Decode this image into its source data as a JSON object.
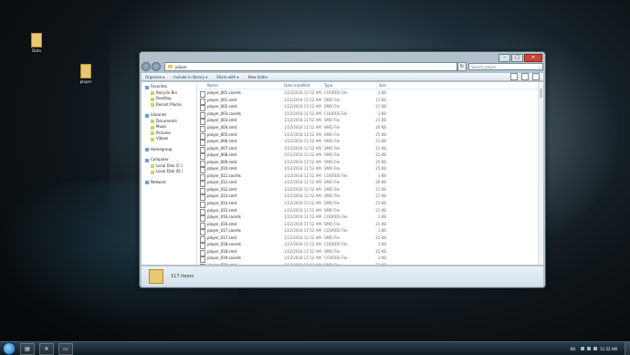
{
  "desktop": {
    "icons": [
      {
        "label": "Data"
      },
      {
        "label": "player"
      }
    ]
  },
  "window": {
    "address_path": "player",
    "search_placeholder": "Search player",
    "window_controls": {
      "minimize": "–",
      "maximize": "□",
      "close": "✕"
    },
    "toolbar": {
      "organize": "Organize ▾",
      "include_in_library": "Include in library ▾",
      "share_with": "Share with ▾",
      "new_folder": "New folder"
    },
    "nav_pane": {
      "favorites": "Favorites",
      "recycle_bin": "Recycle Bin",
      "desktop": "Desktop",
      "recent_places": "Recent Places",
      "libraries": "Libraries",
      "documents": "Documents",
      "music": "Music",
      "pictures": "Pictures",
      "videos": "Videos",
      "homegroup": "Homegroup",
      "computer": "Computer",
      "local_disk_c": "Local Disk (C:)",
      "local_disk_d": "Local Disk (D:)",
      "network": "Network"
    },
    "columns": {
      "name": "Name",
      "date": "Date modified",
      "type": "Type",
      "size": "Size"
    },
    "files": [
      {
        "name": "player_001.coords",
        "date": "1/22/2018 11:52 AM",
        "type": "COORDS File",
        "size": "1 KB"
      },
      {
        "name": "player_001.smd",
        "date": "1/22/2018 11:52 AM",
        "type": "SMD File",
        "size": "12 KB"
      },
      {
        "name": "player_002.smd",
        "date": "1/22/2018 11:52 AM",
        "type": "SMD File",
        "size": "21 KB"
      },
      {
        "name": "player_003.coords",
        "date": "1/22/2018 11:52 AM",
        "type": "COORDS File",
        "size": "1 KB"
      },
      {
        "name": "player_003.smd",
        "date": "1/22/2018 11:52 AM",
        "type": "SMD File",
        "size": "21 KB"
      },
      {
        "name": "player_004.smd",
        "date": "1/22/2018 11:52 AM",
        "type": "SMD File",
        "size": "26 KB"
      },
      {
        "name": "player_005.smd",
        "date": "1/22/2018 11:52 AM",
        "type": "SMD File",
        "size": "25 KB"
      },
      {
        "name": "player_006.smd",
        "date": "1/22/2018 11:52 AM",
        "type": "SMD File",
        "size": "21 KB"
      },
      {
        "name": "player_007.smd",
        "date": "1/22/2018 11:52 AM",
        "type": "SMD File",
        "size": "21 KB"
      },
      {
        "name": "player_008.smd",
        "date": "1/22/2018 11:52 AM",
        "type": "SMD File",
        "size": "21 KB"
      },
      {
        "name": "player_009.smd",
        "date": "1/22/2018 11:52 AM",
        "type": "SMD File",
        "size": "25 KB"
      },
      {
        "name": "player_010.smd",
        "date": "1/22/2018 11:52 AM",
        "type": "SMD File",
        "size": "25 KB"
      },
      {
        "name": "player_011.coords",
        "date": "1/22/2018 11:52 AM",
        "type": "COORDS File",
        "size": "1 KB"
      },
      {
        "name": "player_011.smd",
        "date": "1/22/2018 11:52 AM",
        "type": "SMD File",
        "size": "26 KB"
      },
      {
        "name": "player_012.smd",
        "date": "1/22/2018 11:52 AM",
        "type": "SMD File",
        "size": "21 KB"
      },
      {
        "name": "player_013.smd",
        "date": "1/22/2018 11:52 AM",
        "type": "SMD File",
        "size": "21 KB"
      },
      {
        "name": "player_014.smd",
        "date": "1/22/2018 11:52 AM",
        "type": "SMD File",
        "size": "25 KB"
      },
      {
        "name": "player_015.smd",
        "date": "1/22/2018 11:52 AM",
        "type": "SMD File",
        "size": "21 KB"
      },
      {
        "name": "player_016.coords",
        "date": "1/22/2018 11:52 AM",
        "type": "COORDS File",
        "size": "1 KB"
      },
      {
        "name": "player_016.smd",
        "date": "1/22/2018 11:52 AM",
        "type": "SMD File",
        "size": "21 KB"
      },
      {
        "name": "player_017.coords",
        "date": "1/22/2018 11:52 AM",
        "type": "COORDS File",
        "size": "1 KB"
      },
      {
        "name": "player_017.smd",
        "date": "1/22/2018 11:52 AM",
        "type": "SMD File",
        "size": "25 KB"
      },
      {
        "name": "player_018.coords",
        "date": "1/22/2018 11:52 AM",
        "type": "COORDS File",
        "size": "1 KB"
      },
      {
        "name": "player_018.smd",
        "date": "1/22/2018 11:52 AM",
        "type": "SMD File",
        "size": "25 KB"
      },
      {
        "name": "player_019.coords",
        "date": "1/22/2018 11:52 AM",
        "type": "COORDS File",
        "size": "1 KB"
      },
      {
        "name": "player_019.smd",
        "date": "1/22/2018 11:52 AM",
        "type": "SMD File",
        "size": "21 KB"
      }
    ],
    "item_count": "117 items"
  },
  "taskbar": {
    "language": "EN",
    "time": "11:52 AM"
  },
  "colors": {
    "window_chrome": "#becdd7",
    "close_button": "#c8493a",
    "folder": "#e8c873",
    "taskbar": "#1a2a35"
  }
}
